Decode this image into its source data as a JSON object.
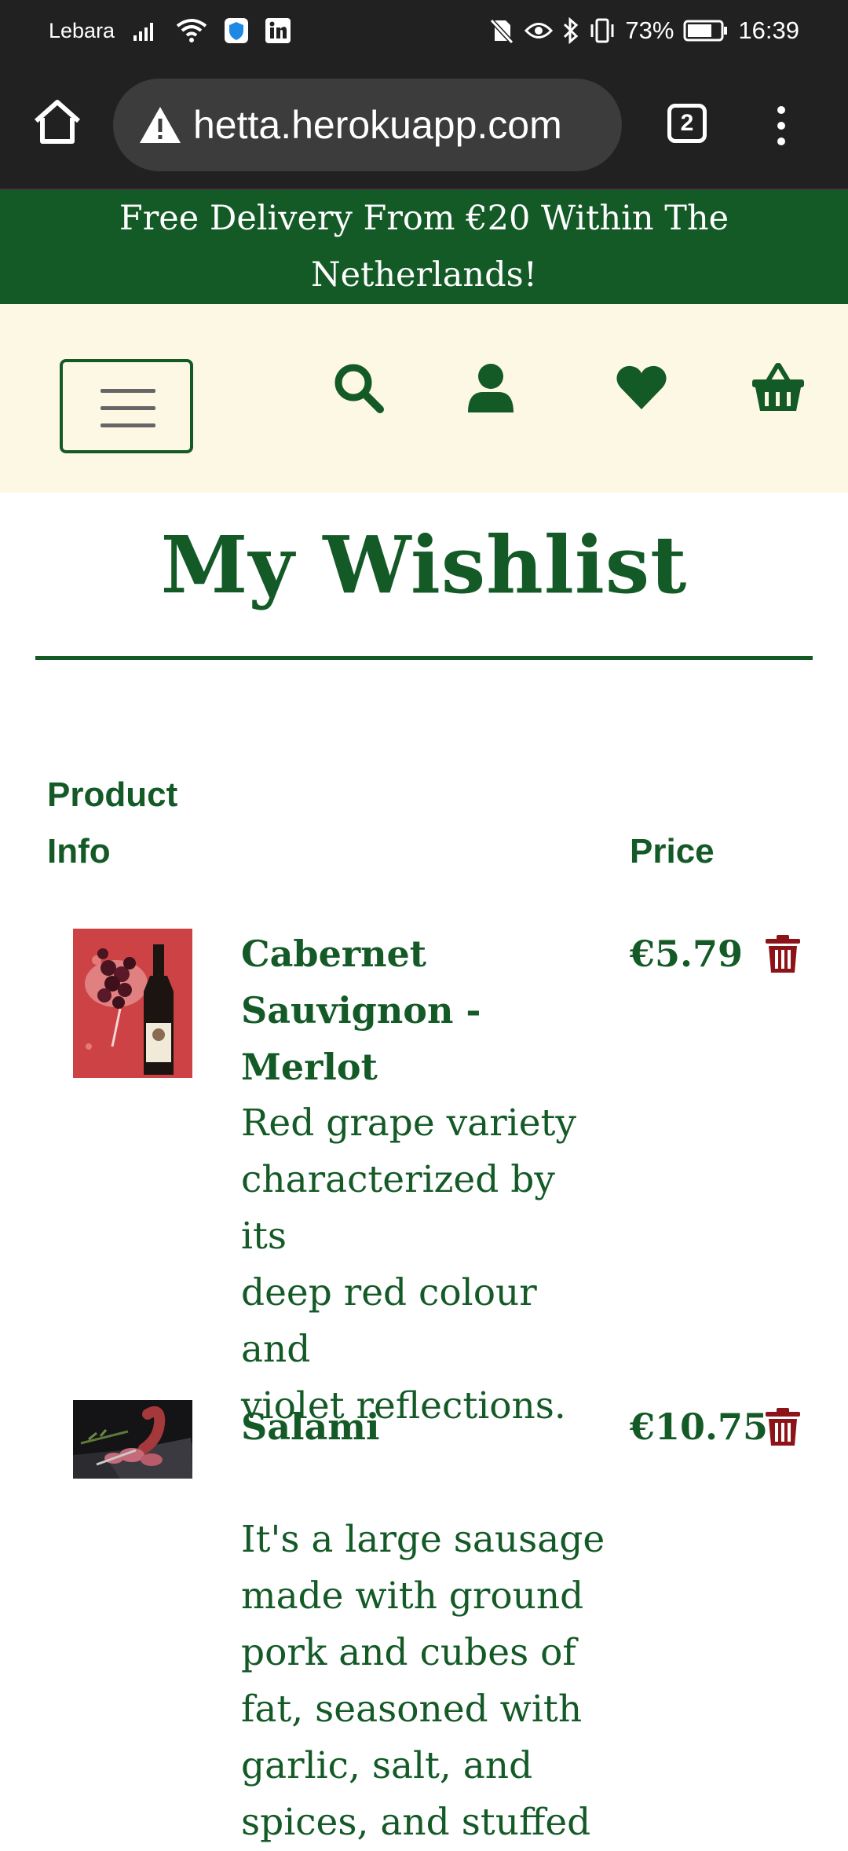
{
  "status_bar": {
    "carrier": "Lebara",
    "battery": "73%",
    "time": "16:39"
  },
  "browser": {
    "url": "hetta.herokuapp.com",
    "tab_count": "2"
  },
  "promo": {
    "line1": "Free Delivery From €20 Within The",
    "line2": "Netherlands!"
  },
  "header": {
    "icons": [
      "menu-icon",
      "search-icon",
      "user-icon",
      "heart-icon",
      "basket-icon"
    ]
  },
  "page": {
    "title": "My Wishlist"
  },
  "table": {
    "col_product_line1": "Product",
    "col_product_line2": "Info",
    "col_price": "Price"
  },
  "items": [
    {
      "name_line1": "Cabernet",
      "name_line2": "Sauvignon - Merlot",
      "price": "€5.79",
      "desc": [
        "Red grape variety",
        "characterized by its",
        "deep red colour and",
        "violet reflections."
      ]
    },
    {
      "name_line1": "Salami",
      "price": "€10.75",
      "desc": [
        "It's a large sausage",
        "made with ground",
        "pork and cubes of",
        "fat, seasoned with",
        "garlic, salt, and",
        "spices, and stuffed"
      ]
    }
  ],
  "colors": {
    "brand_green": "#145a27",
    "header_bg": "#fdf8e3",
    "trash_red": "#8c1318",
    "chrome_dark": "#212121"
  }
}
